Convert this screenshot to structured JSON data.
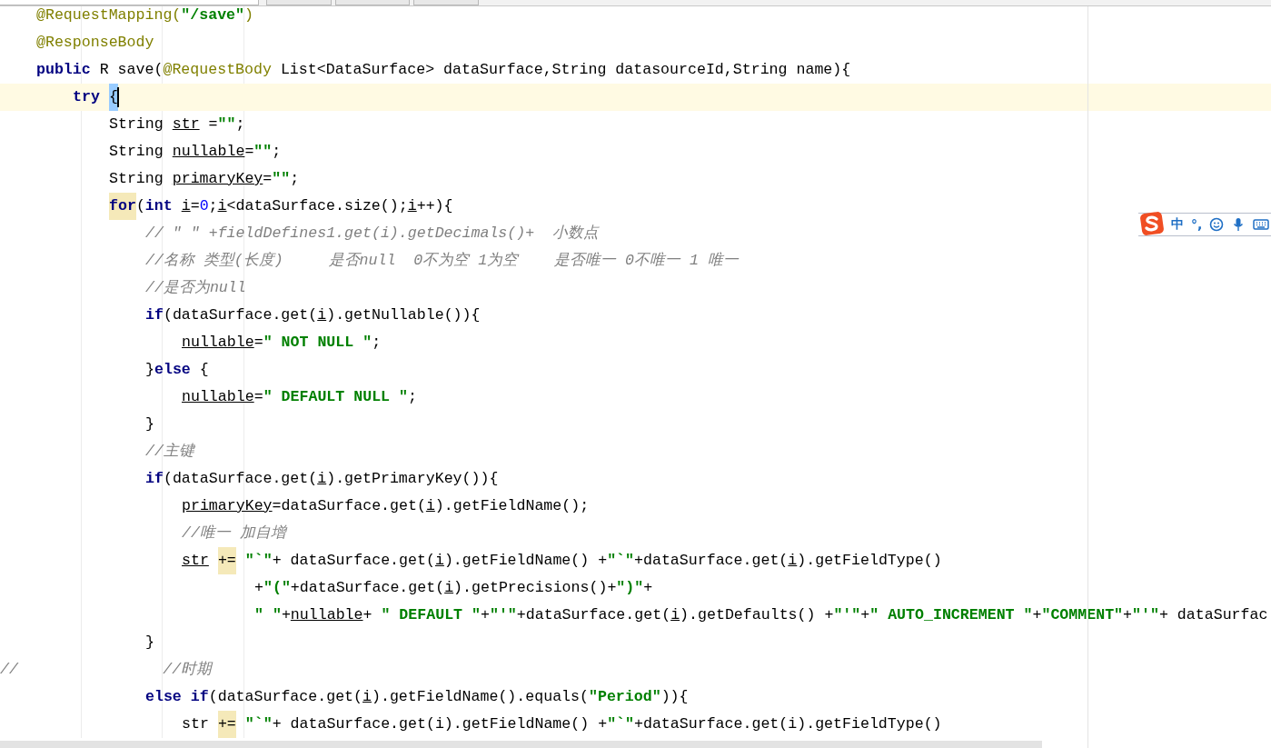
{
  "tabs": [
    {
      "selected": true
    },
    {
      "selected": false
    },
    {
      "selected": false
    },
    {
      "selected": false
    }
  ],
  "editor": {
    "lines": [
      {
        "kind": "statement",
        "current": false,
        "tokens": [
          {
            "kind": "annotation",
            "text": "@RequestMapping("
          },
          {
            "kind": "string",
            "text": "\"/save\""
          },
          {
            "kind": "annotation",
            "text": ")"
          }
        ]
      },
      {
        "kind": "statement",
        "current": false,
        "tokens": [
          {
            "kind": "annotation",
            "text": "@ResponseBody"
          }
        ]
      },
      {
        "kind": "statement",
        "current": false,
        "tokens": [
          {
            "kind": "keyword",
            "text": "public"
          },
          {
            "kind": "plain",
            "text": " R save("
          },
          {
            "kind": "annotation",
            "text": "@RequestBody"
          },
          {
            "kind": "plain",
            "text": " List<DataSurface> dataSurface,String datasourceId,String name){"
          }
        ],
        "children": [
          {
            "kind": "statement",
            "current": true,
            "tokens": [
              {
                "kind": "keyword",
                "text": "try"
              },
              {
                "kind": "brace_match",
                "text": "{"
              }
            ],
            "children": [
              {
                "kind": "statement",
                "current": false,
                "tokens": [
                  {
                    "kind": "plain",
                    "text": "String "
                  },
                  {
                    "kind": "variable",
                    "text": "str"
                  },
                  {
                    "kind": "plain",
                    "text": " ="
                  },
                  {
                    "kind": "string",
                    "text": "\"\""
                  },
                  {
                    "kind": "plain",
                    "text": ";"
                  }
                ]
              },
              {
                "kind": "statement",
                "current": false,
                "tokens": [
                  {
                    "kind": "plain",
                    "text": "String "
                  },
                  {
                    "kind": "variable",
                    "text": "nullable"
                  },
                  {
                    "kind": "plain",
                    "text": "="
                  },
                  {
                    "kind": "string",
                    "text": "\"\""
                  },
                  {
                    "kind": "plain",
                    "text": ";"
                  }
                ]
              },
              {
                "kind": "statement",
                "current": false,
                "tokens": [
                  {
                    "kind": "plain",
                    "text": "String "
                  },
                  {
                    "kind": "variable",
                    "text": "primaryKey"
                  },
                  {
                    "kind": "plain",
                    "text": "="
                  },
                  {
                    "kind": "string",
                    "text": "\"\""
                  },
                  {
                    "kind": "plain",
                    "text": ";"
                  }
                ]
              },
              {
                "kind": "statement",
                "current": false,
                "tokens": [
                  {
                    "kind": "keyword_match",
                    "text": "for"
                  },
                  {
                    "kind": "plain",
                    "text": "("
                  },
                  {
                    "kind": "keyword",
                    "text": "int "
                  },
                  {
                    "kind": "variable",
                    "text": "i"
                  },
                  {
                    "kind": "plain",
                    "text": "="
                  },
                  {
                    "kind": "number",
                    "text": "0"
                  },
                  {
                    "kind": "plain",
                    "text": ";"
                  },
                  {
                    "kind": "variable",
                    "text": "i"
                  },
                  {
                    "kind": "plain",
                    "text": "<dataSurface.size();"
                  },
                  {
                    "kind": "variable",
                    "text": "i"
                  },
                  {
                    "kind": "plain",
                    "text": "++){"
                  }
                ],
                "children": [
                  {
                    "kind": "statement",
                    "current": false,
                    "tokens": [
                      {
                        "kind": "comment",
                        "text": "// \" \" +fieldDefines1.get(i).getDecimals()+  小数点"
                      }
                    ]
                  },
                  {
                    "kind": "statement",
                    "current": false,
                    "tokens": [
                      {
                        "kind": "comment",
                        "text": "//名称 类型(长度)     是否null  0不为空 1为空    是否唯一 0不唯一 1 唯一"
                      }
                    ]
                  },
                  {
                    "kind": "statement",
                    "current": false,
                    "tokens": [
                      {
                        "kind": "comment",
                        "text": "//是否为null"
                      }
                    ]
                  },
                  {
                    "kind": "statement",
                    "current": false,
                    "tokens": [
                      {
                        "kind": "keyword",
                        "text": "if"
                      },
                      {
                        "kind": "plain",
                        "text": "(dataSurface.get("
                      },
                      {
                        "kind": "variable",
                        "text": "i"
                      },
                      {
                        "kind": "plain",
                        "text": ").getNullable()){"
                      }
                    ],
                    "children": [
                      {
                        "kind": "statement",
                        "current": false,
                        "tokens": [
                          {
                            "kind": "variable",
                            "text": "nullable"
                          },
                          {
                            "kind": "plain",
                            "text": "="
                          },
                          {
                            "kind": "string",
                            "text": "\" NOT NULL \""
                          },
                          {
                            "kind": "plain",
                            "text": ";"
                          }
                        ]
                      }
                    ]
                  },
                  {
                    "kind": "statement",
                    "current": false,
                    "tokens": [
                      {
                        "kind": "plain",
                        "text": "}"
                      },
                      {
                        "kind": "keyword",
                        "text": "else"
                      },
                      {
                        "kind": "plain",
                        "text": " {"
                      }
                    ],
                    "children": [
                      {
                        "kind": "statement",
                        "current": false,
                        "tokens": [
                          {
                            "kind": "variable",
                            "text": "nullable"
                          },
                          {
                            "kind": "plain",
                            "text": "="
                          },
                          {
                            "kind": "string",
                            "text": "\" DEFAULT NULL \""
                          },
                          {
                            "kind": "plain",
                            "text": ";"
                          }
                        ]
                      }
                    ]
                  },
                  {
                    "kind": "statement",
                    "current": false,
                    "tokens": [
                      {
                        "kind": "plain",
                        "text": "}"
                      }
                    ]
                  },
                  {
                    "kind": "statement",
                    "current": false,
                    "tokens": [
                      {
                        "kind": "comment",
                        "text": "//主键"
                      }
                    ]
                  },
                  {
                    "kind": "statement",
                    "current": false,
                    "tokens": [
                      {
                        "kind": "keyword",
                        "text": "if"
                      },
                      {
                        "kind": "plain",
                        "text": "(dataSurface.get("
                      },
                      {
                        "kind": "variable",
                        "text": "i"
                      },
                      {
                        "kind": "plain",
                        "text": ").getPrimaryKey()){"
                      }
                    ],
                    "children": [
                      {
                        "kind": "statement",
                        "current": false,
                        "tokens": [
                          {
                            "kind": "variable",
                            "text": "primaryKey"
                          },
                          {
                            "kind": "plain",
                            "text": "=dataSurface.get("
                          },
                          {
                            "kind": "variable",
                            "text": "i"
                          },
                          {
                            "kind": "plain",
                            "text": ").getFieldName();"
                          }
                        ]
                      },
                      {
                        "kind": "statement",
                        "current": false,
                        "tokens": [
                          {
                            "kind": "comment",
                            "text": "//唯一 加自增"
                          }
                        ]
                      },
                      {
                        "kind": "statement",
                        "current": false,
                        "tokens": [
                          {
                            "kind": "variable",
                            "text": "str"
                          },
                          {
                            "kind": "operator_match",
                            "text": "+="
                          },
                          {
                            "kind": "string",
                            "text": "\"`\""
                          },
                          {
                            "kind": "plain",
                            "text": "+ dataSurface.get("
                          },
                          {
                            "kind": "variable",
                            "text": "i"
                          },
                          {
                            "kind": "plain",
                            "text": ").getFieldName() +"
                          },
                          {
                            "kind": "string",
                            "text": "\"`\""
                          },
                          {
                            "kind": "plain",
                            "text": "+dataSurface.get("
                          },
                          {
                            "kind": "variable",
                            "text": "i"
                          },
                          {
                            "kind": "plain",
                            "text": ").getFieldType()"
                          }
                        ],
                        "children": [
                          {
                            "kind": "continuation",
                            "current": false,
                            "tokens": [
                              {
                                "kind": "plain",
                                "text": "+"
                              },
                              {
                                "kind": "string",
                                "text": "\"(\""
                              },
                              {
                                "kind": "plain",
                                "text": "+dataSurface.get("
                              },
                              {
                                "kind": "variable",
                                "text": "i"
                              },
                              {
                                "kind": "plain",
                                "text": ").getPrecisions()+"
                              },
                              {
                                "kind": "string",
                                "text": "\")\""
                              },
                              {
                                "kind": "plain",
                                "text": "+"
                              }
                            ]
                          },
                          {
                            "kind": "continuation",
                            "current": false,
                            "tokens": [
                              {
                                "kind": "string",
                                "text": "\" \""
                              },
                              {
                                "kind": "plain",
                                "text": "+"
                              },
                              {
                                "kind": "variable",
                                "text": "nullable"
                              },
                              {
                                "kind": "plain",
                                "text": "+ "
                              },
                              {
                                "kind": "string",
                                "text": "\" DEFAULT \""
                              },
                              {
                                "kind": "plain",
                                "text": "+"
                              },
                              {
                                "kind": "string",
                                "text": "\"'\""
                              },
                              {
                                "kind": "plain",
                                "text": "+dataSurface.get("
                              },
                              {
                                "kind": "variable",
                                "text": "i"
                              },
                              {
                                "kind": "plain",
                                "text": ").getDefaults() +"
                              },
                              {
                                "kind": "string",
                                "text": "\"'\""
                              },
                              {
                                "kind": "plain",
                                "text": "+"
                              },
                              {
                                "kind": "string",
                                "text": "\" AUTO_INCREMENT \""
                              },
                              {
                                "kind": "plain",
                                "text": "+"
                              },
                              {
                                "kind": "string",
                                "text": "\"COMMENT\""
                              },
                              {
                                "kind": "plain",
                                "text": "+"
                              },
                              {
                                "kind": "string",
                                "text": "\"'\""
                              },
                              {
                                "kind": "plain",
                                "text": "+ dataSurfac"
                              }
                            ]
                          }
                        ]
                      }
                    ]
                  },
                  {
                    "kind": "statement",
                    "current": false,
                    "tokens": [
                      {
                        "kind": "plain",
                        "text": "}"
                      }
                    ]
                  },
                  {
                    "kind": "commented_out",
                    "current": false,
                    "tokens": [
                      {
                        "kind": "comment",
                        "text": "//                //时期"
                      }
                    ]
                  },
                  {
                    "kind": "statement",
                    "current": false,
                    "tokens": [
                      {
                        "kind": "keyword",
                        "text": "else if"
                      },
                      {
                        "kind": "plain",
                        "text": "(dataSurface.get("
                      },
                      {
                        "kind": "variable",
                        "text": "i"
                      },
                      {
                        "kind": "plain",
                        "text": ").getFieldName().equals("
                      },
                      {
                        "kind": "string",
                        "text": "\"Period\""
                      },
                      {
                        "kind": "plain",
                        "text": ")){"
                      }
                    ],
                    "children": [
                      {
                        "kind": "statement",
                        "current": false,
                        "tokens": [
                          {
                            "kind": "plain",
                            "text": "str"
                          },
                          {
                            "kind": "operator_match",
                            "text": "+="
                          },
                          {
                            "kind": "string",
                            "text": "\"`\""
                          },
                          {
                            "kind": "plain",
                            "text": "+ dataSurface.get(i).getFieldName() +"
                          },
                          {
                            "kind": "string",
                            "text": "\"`\""
                          },
                          {
                            "kind": "plain",
                            "text": "+dataSurface.get(i).getFieldType()"
                          }
                        ]
                      }
                    ]
                  }
                ]
              }
            ]
          }
        ]
      }
    ]
  },
  "ime_toolbar": {
    "language": "中",
    "punctuation": "°,"
  }
}
